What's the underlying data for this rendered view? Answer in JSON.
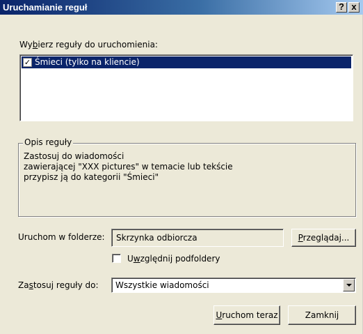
{
  "window": {
    "title": "Uruchamianie reguł",
    "help_label": "?",
    "close_label": "x"
  },
  "rules": {
    "label_prefix": "Wy",
    "label_accel": "b",
    "label_suffix": "ierz reguły do uruchomienia:",
    "items": [
      {
        "checked": true,
        "label": "Śmieci  (tylko na kliencie)"
      }
    ]
  },
  "description": {
    "legend": "Opis reguły",
    "lines": [
      "Zastosuj do wiadomości",
      "zawierającej \"XXX pictures\" w temacie lub tekście",
      "przypisz ją do kategorii \"Śmieci\""
    ]
  },
  "folder": {
    "label": "Uruchom w folderze:",
    "value": "Skrzynka odbiorcza",
    "browse_accel": "P",
    "browse_rest": "rzeglądaj..."
  },
  "subfolders": {
    "checked": false,
    "label_prefix": "U",
    "label_accel": "w",
    "label_suffix": "zględnij podfoldery"
  },
  "apply_to": {
    "label_prefix": "Za",
    "label_accel": "s",
    "label_suffix": "tosuj reguły do:",
    "selected": "Wszystkie wiadomości"
  },
  "buttons": {
    "run_accel": "U",
    "run_rest": "ruchom teraz",
    "close": "Zamknij"
  },
  "colors": {
    "title_start": "#0a246a",
    "title_end": "#a6caf0",
    "selection": "#0a246a",
    "face": "#ece9d8"
  }
}
